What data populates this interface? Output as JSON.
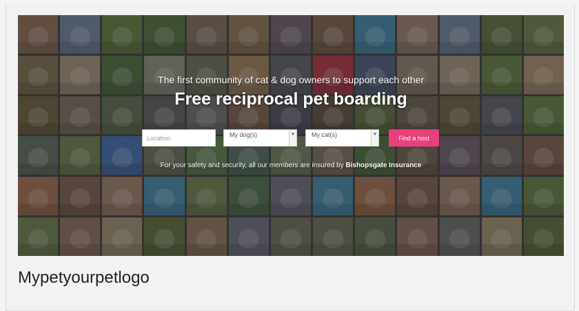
{
  "hero": {
    "subtitle": "The first community of cat & dog owners to support each other",
    "title": "Free reciprocal pet boarding",
    "insurance_text": "For your safety and security, all our members are insured by ",
    "insurance_brand": "Bishopsgate Insurance"
  },
  "search": {
    "location_placeholder": "Location",
    "dog_select_value": "My dog(s)",
    "cat_select_value": "My cat(s)",
    "find_button_label": "Find a host"
  },
  "caption": "Mypetyourpetlogo",
  "colors": {
    "accent": "#e8407d",
    "tiles": [
      "#8a6a52",
      "#6d7f9a",
      "#5f7a3e",
      "#4f6b3a",
      "#7a6a5a",
      "#8a7055",
      "#6a5a6a",
      "#7b5d48",
      "#3f86a8",
      "#9a7d6a",
      "#6d7f9a",
      "#5a6d3e",
      "#6a7a48",
      "#7a6a4a",
      "#a08d75",
      "#4a6a3a",
      "#8a8a7a",
      "#6a6a5a",
      "#9a7a55",
      "#5a5a6a",
      "#b03040",
      "#4a5a7a",
      "#8a7a6a",
      "#a08d75",
      "#5f7a3e",
      "#a88a6a",
      "#6a5a3a",
      "#7a6a5a",
      "#5a6a4a",
      "#5a5a5a",
      "#6a6a6a",
      "#7a5a4a",
      "#4a4a5a",
      "#5a4a3a",
      "#5a6a3a",
      "#6a5a4a",
      "#6a5a3a",
      "#5a5a6a",
      "#5f7a3e",
      "#5a6a5a",
      "#6a7a4a",
      "#3f6ab0",
      "#6a6a5a",
      "#5a7a4a",
      "#4a6a5a",
      "#6a7a5a",
      "#7a6a5a",
      "#4a6a3a",
      "#6a5a4a",
      "#6a5a6a",
      "#6a5a5a",
      "#7a5a4a",
      "#a06a4a",
      "#7a5a4a",
      "#9a7a65",
      "#3f86a8",
      "#6a7a4a",
      "#4a6a4a",
      "#6a6a7a",
      "#3f86a8",
      "#a06a4a",
      "#7a5a4a",
      "#9a7a65",
      "#3f86a8",
      "#5f7a3e",
      "#6a7a4a",
      "#8a6a5a",
      "#9a8a6a",
      "#5a6a3a",
      "#8a7055",
      "#6a6a7a",
      "#6a6a5a",
      "#6a6a5a",
      "#5a6a4a",
      "#8a6a5a",
      "#6a6a6a",
      "#9a8a6a",
      "#5a6a3a"
    ]
  },
  "tile_icons": [
    "pet-photo-icon"
  ]
}
